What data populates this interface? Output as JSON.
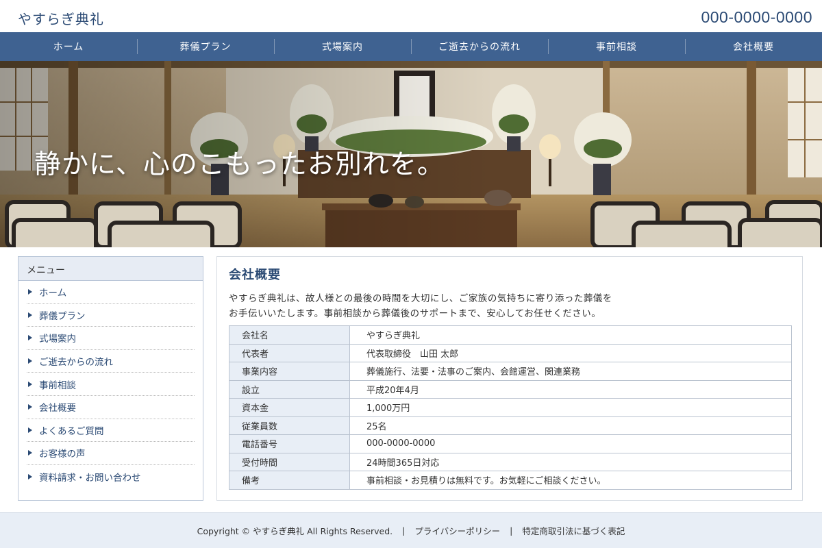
{
  "header": {
    "logo": "やすらぎ典礼",
    "phone": "000-0000-0000"
  },
  "nav": [
    "ホーム",
    "葬儀プラン",
    "式場案内",
    "ご逝去からの流れ",
    "事前相談",
    "会社概要"
  ],
  "hero": {
    "copy": "静かに、心のこもったお別れを。"
  },
  "sidebar": {
    "title": "メニュー",
    "items": [
      "ホーム",
      "葬儀プラン",
      "式場案内",
      "ご逝去からの流れ",
      "事前相談",
      "会社概要",
      "よくあるご質問",
      "お客様の声",
      "資料請求・お問い合わせ"
    ]
  },
  "main": {
    "title": "会社概要",
    "intro_line1": "やすらぎ典礼は、故人様との最後の時間を大切にし、ご家族の気持ちに寄り添った葬儀を",
    "intro_line2": "お手伝いいたします。事前相談から葬儀後のサポートまで、安心してお任せください。",
    "table": [
      {
        "label": "会社名",
        "value": "やすらぎ典礼"
      },
      {
        "label": "代表者",
        "value": "代表取締役　山田 太郎"
      },
      {
        "label": "事業内容",
        "value": "葬儀施行、法要・法事のご案内、会館運営、関連業務"
      },
      {
        "label": "設立",
        "value": "平成20年4月"
      },
      {
        "label": "資本金",
        "value": "1,000万円"
      },
      {
        "label": "従業員数",
        "value": "25名"
      },
      {
        "label": "電話番号",
        "value": "000-0000-0000"
      },
      {
        "label": "受付時間",
        "value": "24時間365日対応"
      },
      {
        "label": "備考",
        "value": "事前相談・お見積りは無料です。お気軽にご相談ください。"
      }
    ]
  },
  "footer": {
    "copyright": "Copyright ©  やすらぎ典礼  All Rights Reserved.",
    "sep": "|",
    "privacy": "プライバシーポリシー",
    "tokusho": "特定商取引法に基づく表記"
  },
  "colors": {
    "brand": "#2b4a74",
    "nav_bg": "#3f6291",
    "table_header_bg": "#e8eef6",
    "footer_bg": "#e8eef6"
  }
}
